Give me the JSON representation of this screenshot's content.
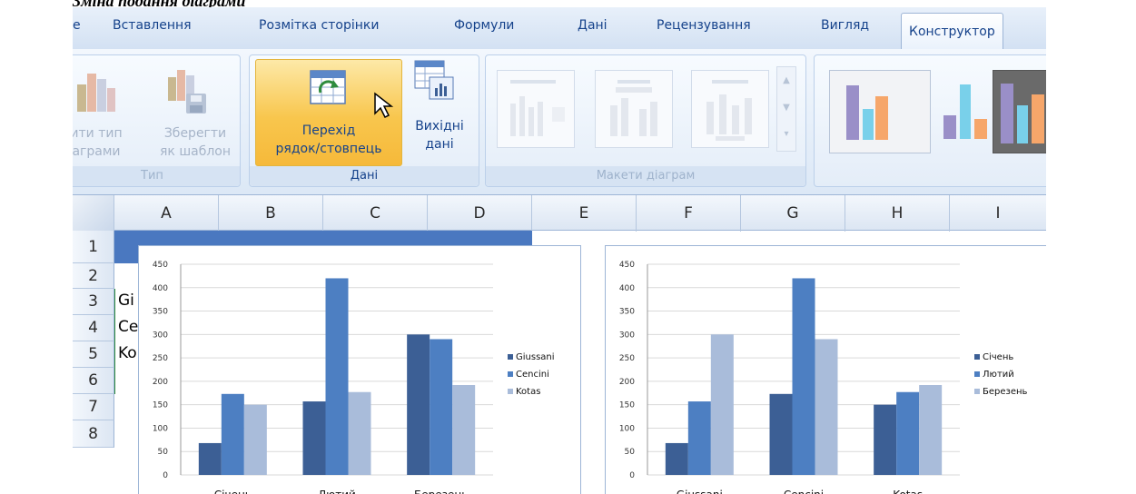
{
  "page_title": "Зміна подання діаграми",
  "tabs": [
    "е",
    "Вставлення",
    "Розмітка сторінки",
    "Формули",
    "Дані",
    "Рецензування",
    "Вигляд",
    "Конструктор"
  ],
  "active_tab": "Конструктор",
  "ribbon": {
    "type_group": {
      "label": "Тип",
      "change_type_line1": "ити тип",
      "change_type_line2": "аграми",
      "save_template_line1": "Зберегти",
      "save_template_line2": "як шаблон"
    },
    "data_group": {
      "label": "Дані",
      "switch_line1": "Перехід",
      "switch_line2": "рядок/стовпець",
      "source_line1": "Вихідні",
      "source_line2": "дані"
    },
    "layouts_group": {
      "label": "Макети діаграм"
    }
  },
  "columns": [
    "A",
    "B",
    "C",
    "D",
    "E",
    "F",
    "G",
    "H",
    "I"
  ],
  "rows": [
    "1",
    "2",
    "3",
    "4",
    "5",
    "6",
    "7",
    "8"
  ],
  "cells": {
    "A3": "Gi",
    "A4": "Ce",
    "A5": "Ko"
  },
  "colors": {
    "series1": "#3c5f95",
    "series2": "#4d7fc2",
    "series3": "#a9bcda",
    "gridline": "#d9d9d9",
    "accent": "#f9c846"
  },
  "chart_data": [
    {
      "type": "bar",
      "categories": [
        "Січень",
        "Лютий",
        "Березень"
      ],
      "series": [
        {
          "name": "Giussani",
          "values": [
            68,
            157,
            300
          ]
        },
        {
          "name": "Cencini",
          "values": [
            173,
            420,
            290
          ]
        },
        {
          "name": "Kotas",
          "values": [
            150,
            177,
            192
          ]
        }
      ],
      "yticks": [
        "0",
        "50",
        "100",
        "150",
        "200",
        "250",
        "300",
        "350",
        "400",
        "450"
      ],
      "ylim": [
        0,
        450
      ],
      "legend": "right"
    },
    {
      "type": "bar",
      "categories": [
        "Giussani",
        "Cencini",
        "Kotas"
      ],
      "series": [
        {
          "name": "Січень",
          "values": [
            68,
            173,
            150
          ]
        },
        {
          "name": "Лютий",
          "values": [
            157,
            420,
            177
          ]
        },
        {
          "name": "Березень",
          "values": [
            300,
            290,
            192
          ]
        }
      ],
      "yticks": [
        "0",
        "50",
        "100",
        "150",
        "200",
        "250",
        "300",
        "350",
        "400",
        "450"
      ],
      "ylim": [
        0,
        450
      ],
      "legend": "right"
    }
  ]
}
